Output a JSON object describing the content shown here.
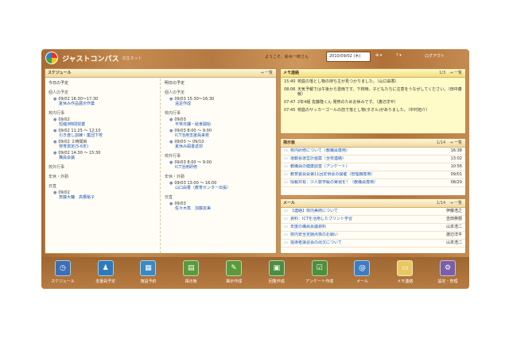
{
  "app": {
    "title": "ジャストコンパス",
    "subtitle": "先生ネット",
    "welcome": "ようこそ、鈴木一郎さん",
    "date": "2010/09/02 (木)",
    "zoom": "⊕ ▾",
    "help": "? ▾",
    "logout": "ログアウト"
  },
  "schedule": {
    "title": "スケジュール",
    "ctrl": "⇥ 一覧",
    "today": {
      "label": "今日の予定",
      "cats": [
        {
          "name": "個人の予定",
          "events": [
            {
              "time": "09/02 16:30～17:30",
              "subject": "夏休み作品展示作業"
            }
          ]
        },
        {
          "name": "校内行事",
          "events": [
            {
              "time": "09/02",
              "subject": "短縮3時間授業"
            },
            {
              "time": "09/02 11:25 ～ 12:10",
              "subject": "引き渡し訓練・集団下校"
            },
            {
              "time": "09/02 ２時間目",
              "subject": "発育測定(5-6年)"
            },
            {
              "time": "09/02 14:30 ～ 15:30",
              "subject": "職員会議"
            }
          ]
        },
        {
          "name": "校外行事",
          "events": []
        },
        {
          "name": "年休・外勤",
          "events": []
        },
        {
          "name": "日直",
          "events": [
            {
              "time": "09/02",
              "subject": "斎藤大輔　高橋裕子"
            }
          ]
        }
      ]
    },
    "tomorrow": {
      "label": "明日の予定",
      "cats": [
        {
          "name": "個人の予定",
          "events": [
            {
              "time": "09/03 15:30～16:30",
              "subject": "遠足作成"
            }
          ]
        },
        {
          "name": "校内行事",
          "events": [
            {
              "time": "09/03",
              "subject": "平常日課・給食開始"
            },
            {
              "time": "09/03 8:00 ～ 9:00",
              "subject": "ICT活用支援員来校"
            },
            {
              "time": "09/03 ～ 09/10",
              "subject": "夏休み図書返却"
            }
          ]
        },
        {
          "name": "校外行事",
          "events": [
            {
              "time": "09/03 8:00 ～ 9:00",
              "subject": "ICT活用研修"
            }
          ]
        },
        {
          "name": "年休・外勤",
          "events": [
            {
              "time": "09/03 13:00 ～ 16:00",
              "subject": "山口由香（教育センター出張）"
            }
          ]
        },
        {
          "name": "日直",
          "events": [
            {
              "time": "09/03",
              "subject": "佐々木篤　加藤友美"
            }
          ]
        }
      ]
    }
  },
  "memo": {
    "title": "メモ連絡",
    "pager": "1/3",
    "ctrl": "⇥ 一覧",
    "rows": [
      {
        "time": "15:40",
        "text": "校庭の落とし物の持ち主が見つかりました。（山口由香）"
      },
      {
        "time": "08:06",
        "text": "天気予報では午後から雷雨です。下校時、子どもたちに注意をうながしてください。（田中康敏）"
      },
      {
        "time": "07:47",
        "text": "2年4組 佐藤隆くん 発熱のためお休みです。（渡辺洋平）"
      },
      {
        "time": "07:45",
        "text": "校庭のサッカーゴールの前で落とし物(タオル)がありました。（中村拓介）"
      }
    ]
  },
  "notice": {
    "title": "掲示板",
    "pager": "1/14",
    "ctrl": "⇥ 一覧",
    "rows": [
      {
        "title": "校内研修について（教職員専用）",
        "right": "16:38"
      },
      {
        "title": "運動会運営計画案（全校連絡）",
        "right": "13:02"
      },
      {
        "title": "教職員の健康調査（アンケート）",
        "right": "10:56"
      },
      {
        "title": "教育委員会第11回定例会の開催（管理職専用）",
        "right": "09/01"
      },
      {
        "title": "情報共有：少人数学級の実現を！（教職員専用）",
        "right": "08/29"
      }
    ]
  },
  "mail": {
    "title": "メール",
    "pager": "1/14",
    "ctrl": "⇥ 一覧",
    "rows": [
      {
        "title": "【連絡】校内美術について",
        "right": "伊藤浩之"
      },
      {
        "title": "資料：ICTを活用したプリント学習",
        "right": "吉田英樹"
      },
      {
        "title": "年度の職員会議資料",
        "right": "山本浩二"
      },
      {
        "title": "校内安全定期点検のお願い",
        "right": "渡辺洋平"
      },
      {
        "title": "指導者講習会の出欠について",
        "right": "山本浩二"
      }
    ]
  },
  "dock": [
    {
      "label": "スケジュール",
      "icon": "clock-icon",
      "color": "#3b6fb6",
      "glyph": "◷"
    },
    {
      "label": "支援員予定",
      "icon": "people-icon",
      "color": "#2f7ab8",
      "glyph": "♟"
    },
    {
      "label": "施設予約",
      "icon": "building-icon",
      "color": "#3a88c4",
      "glyph": "▦"
    },
    {
      "label": "掲示板",
      "icon": "board-icon",
      "color": "#5a9a3a",
      "glyph": "▤"
    },
    {
      "label": "掲示作成",
      "icon": "board-edit-icon",
      "color": "#5a9a3a",
      "glyph": "✎"
    },
    {
      "label": "回覧作成",
      "icon": "circular-icon",
      "color": "#4c8e40",
      "glyph": "▣"
    },
    {
      "label": "アンケート作成",
      "icon": "survey-icon",
      "color": "#4f8f3b",
      "glyph": "☑"
    },
    {
      "label": "メール",
      "icon": "mail-icon",
      "color": "#3d7cc0",
      "glyph": "@"
    },
    {
      "label": "メモ連絡",
      "icon": "memo-icon",
      "color": "#e8c860",
      "glyph": "▭"
    },
    {
      "label": "設定・管理",
      "icon": "settings-icon",
      "color": "#7a5ea8",
      "glyph": "⚙"
    }
  ]
}
